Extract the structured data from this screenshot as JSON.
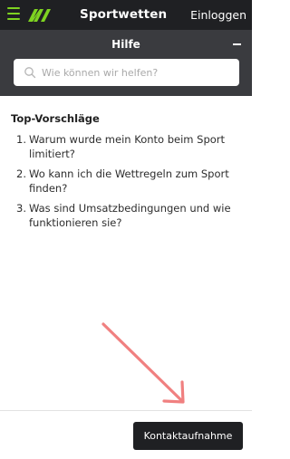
{
  "header": {
    "menu_icon": "hamburger-menu-icon",
    "logo_icon": "brand-logo-icon",
    "title": "Sportwetten",
    "login_label": "Einloggen",
    "accent_color": "#7ed321",
    "background_color": "#1f2023"
  },
  "help": {
    "title": "Hilfe",
    "minimize_icon": "minimize-icon",
    "search_placeholder": "Wie können wir helfen?",
    "search_icon": "search-icon",
    "background_color": "#3a3b3f"
  },
  "suggestions": {
    "title": "Top-Vorschläge",
    "items": [
      {
        "number": "1.",
        "text": "Warum wurde mein Konto beim Sport limitiert?"
      },
      {
        "number": "2.",
        "text": "Wo kann ich die Wettregeln zum Sport finden?"
      },
      {
        "number": "3.",
        "text": "Was sind Umsatzbedingungen und wie funktionieren sie?"
      }
    ]
  },
  "annotation": {
    "icon": "pointer-arrow-icon",
    "color": "#f08080"
  },
  "footer": {
    "contact_label": "Kontaktaufnahme"
  }
}
